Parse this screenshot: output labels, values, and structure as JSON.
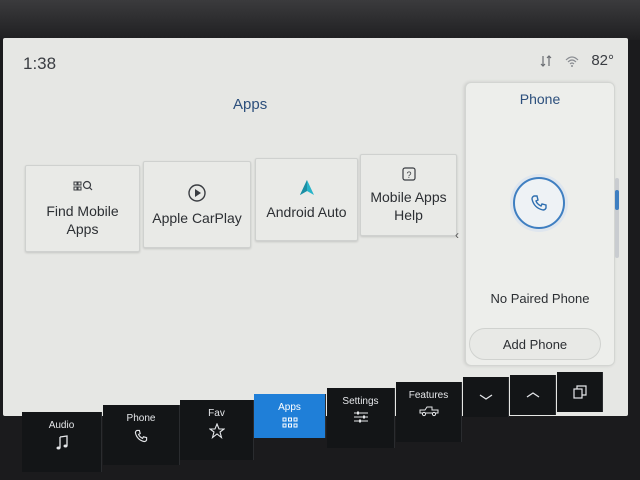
{
  "status": {
    "time": "1:38",
    "temperature": "82°"
  },
  "apps": {
    "title": "Apps",
    "tiles": [
      {
        "label_line1": "Find Mobile",
        "label_line2": "Apps",
        "icon": "search-apps-icon"
      },
      {
        "label_line1": "Apple CarPlay",
        "label_line2": "",
        "icon": "carplay-icon"
      },
      {
        "label_line1": "Android Auto",
        "label_line2": "",
        "icon": "android-auto-icon"
      },
      {
        "label_line1": "Mobile Apps",
        "label_line2": "Help",
        "icon": "help-icon"
      }
    ]
  },
  "phone_panel": {
    "title": "Phone",
    "status_text": "No Paired Phone",
    "add_button": "Add Phone"
  },
  "nav": {
    "audio": "Audio",
    "phone": "Phone",
    "fav": "Fav",
    "apps": "Apps",
    "settings": "Settings",
    "features": "Features"
  },
  "colors": {
    "accent": "#1f7fd8",
    "title_blue": "#2c4f7c",
    "android_auto": "#27b4c9"
  }
}
